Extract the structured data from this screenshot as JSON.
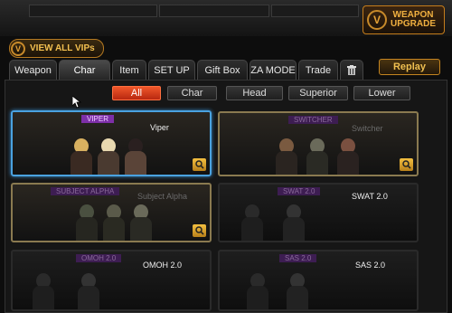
{
  "topbar": {
    "weapon_upgrade_line1": "WEAPON",
    "weapon_upgrade_line2": "UPGRADE",
    "weapon_upgrade_badge": "V"
  },
  "vip": {
    "badge": "V",
    "label": "VIEW ALL VIPs"
  },
  "tabs": [
    {
      "label": "Weapon",
      "active": false
    },
    {
      "label": "Char",
      "active": true
    },
    {
      "label": "Item",
      "active": false
    },
    {
      "label": "SET UP",
      "active": false
    },
    {
      "label": "Gift Box",
      "active": false
    },
    {
      "label": "ZA MODE",
      "active": false
    },
    {
      "label": "Trade",
      "active": false
    }
  ],
  "trash_icon": "trash-icon",
  "replay_label": "Replay",
  "filters": [
    {
      "label": "All",
      "active": true
    },
    {
      "label": "Char",
      "active": false
    },
    {
      "label": "Head",
      "active": false
    },
    {
      "label": "Superior",
      "active": false
    },
    {
      "label": "Lower",
      "active": false
    }
  ],
  "cards": [
    {
      "tag": "VIPER",
      "name": "Viper",
      "state": "selected",
      "dim": false,
      "zoom": true
    },
    {
      "tag": "SWITCHER",
      "name": "Switcher",
      "state": "gold",
      "dim": true,
      "zoom": true
    },
    {
      "tag": "SUBJECT ALPHA",
      "name": "Subject Alpha",
      "state": "gold",
      "dim": true,
      "zoom": true
    },
    {
      "tag": "SWAT 2.0",
      "name": "SWAT 2.0",
      "state": "dark",
      "dim": false,
      "zoom": false
    },
    {
      "tag": "OMOH 2.0",
      "name": "OMOH 2.0",
      "state": "dark",
      "dim": false,
      "zoom": false
    },
    {
      "tag": "SAS 2.0",
      "name": "SAS 2.0",
      "state": "dark",
      "dim": false,
      "zoom": false
    }
  ],
  "colors": {
    "accent_orange": "#f0572a",
    "gold": "#f0b040",
    "selected_blue": "#4aa2e0",
    "tag_purple": "#7d2fa8"
  }
}
